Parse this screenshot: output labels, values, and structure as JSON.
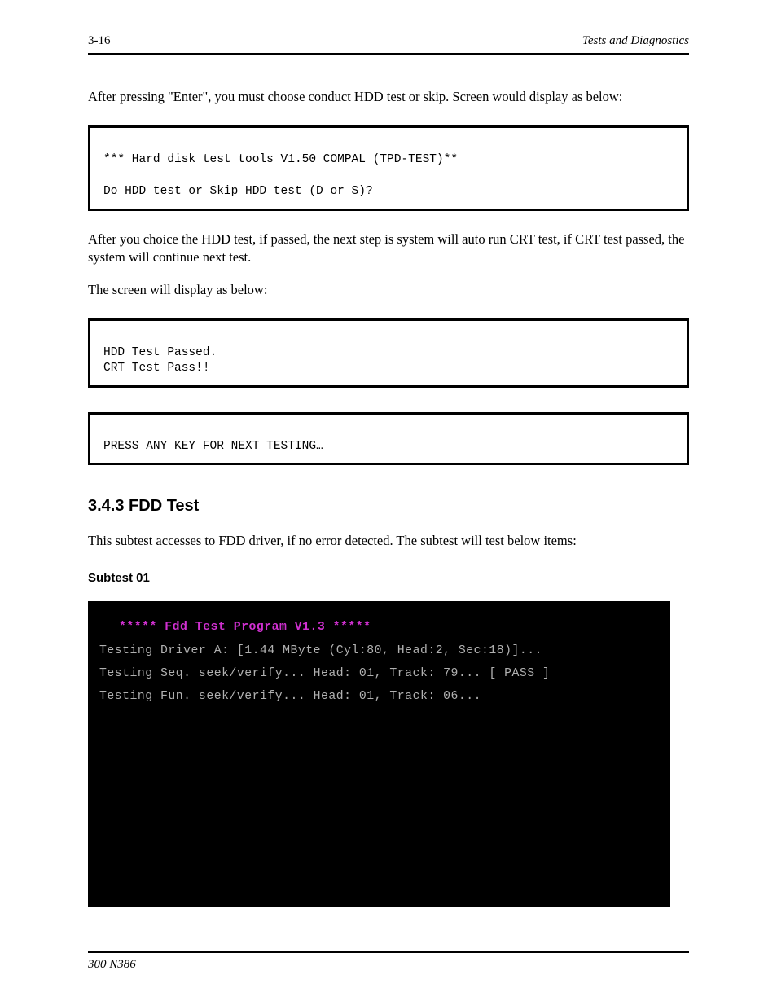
{
  "header": {
    "page_number": "3-16",
    "chapter": "Tests and Diagnostics"
  },
  "intro_text": "After pressing \"Enter\", you must choose conduct HDD test or skip. Screen would display as below:",
  "box1": {
    "line1": "*** Hard disk test tools V1.50 COMPAL (TPD-TEST)**",
    "line2": "Do HDD test or Skip HDD test (D or S)?"
  },
  "after_box1": {
    "p1": "After you choice the HDD test, if passed, the next step is system will auto run CRT test, if CRT test passed, the system will continue next test.",
    "p2": "The screen will display as below:"
  },
  "box2": {
    "line1": "HDD Test Passed.",
    "line2": "CRT Test Pass!!"
  },
  "box3_text": "PRESS ANY KEY FOR NEXT TESTING…",
  "section_title": "3.4.3 FDD Test",
  "fdd_para": "This subtest accesses to FDD driver, if no error detected. The subtest will test below items:",
  "subtest_label": "Subtest 01",
  "terminal": {
    "title": "*****  Fdd  Test  Program  V1.3   *****",
    "line1": "Testing  Driver  A:  [1.44  MByte  (Cyl:80,  Head:2,  Sec:18)]...",
    "line2": "Testing  Seq.  seek/verify...  Head:  01,  Track:  79...   [  PASS  ]",
    "line3": "Testing  Fun.  seek/verify...  Head:  01,  Track:  06..."
  },
  "footer": {
    "model": "300 N386"
  }
}
